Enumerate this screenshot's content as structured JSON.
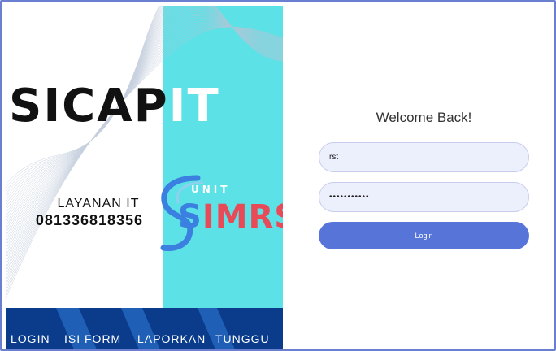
{
  "brand": {
    "title_main": "SICAP",
    "title_suffix": "IT",
    "service_label": "LAYANAN IT",
    "service_phone": "081336818356",
    "logo": {
      "small_text": "UNIT",
      "word_part1": "S",
      "word_part2": "IMRS",
      "colors": {
        "primary": "#3b7fe0",
        "accent": "#e84a57"
      }
    }
  },
  "steps": [
    "LOGIN",
    "ISI FORM",
    "LAPORKAN",
    "TUNGGU"
  ],
  "login": {
    "welcome": "Welcome Back!",
    "username_value": "rst",
    "password_value": "•••••••••••",
    "button_label": "Login"
  },
  "colors": {
    "cyan": "#5ce1e6",
    "steps_bar": "#0b3c8c",
    "button": "#5775d9",
    "field_bg": "#ecf0fd"
  }
}
